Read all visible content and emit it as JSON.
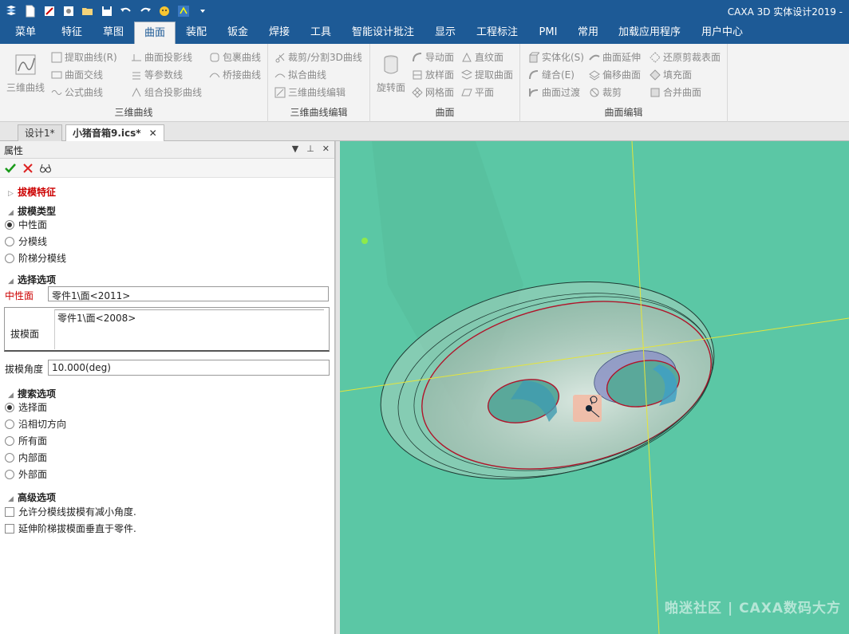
{
  "titlebar": {
    "title": "CAXA 3D 实体设计2019 -"
  },
  "menu": {
    "tabs": [
      {
        "label": "菜单"
      },
      {
        "label": "特征"
      },
      {
        "label": "草图"
      },
      {
        "label": "曲面"
      },
      {
        "label": "装配"
      },
      {
        "label": "钣金"
      },
      {
        "label": "焊接"
      },
      {
        "label": "工具"
      },
      {
        "label": "智能设计批注"
      },
      {
        "label": "显示"
      },
      {
        "label": "工程标注"
      },
      {
        "label": "PMI"
      },
      {
        "label": "常用"
      },
      {
        "label": "加载应用程序"
      },
      {
        "label": "用户中心"
      }
    ],
    "active": "曲面"
  },
  "ribbon": {
    "curves3d": {
      "label": "三维曲线",
      "big": "三维曲线",
      "items": [
        "提取曲线(R)",
        "曲面投影线",
        "包裹曲线",
        "曲面交线",
        "等参数线",
        "桥接曲线",
        "公式曲线",
        "组合投影曲线"
      ]
    },
    "curve_edit": {
      "label": "三维曲线编辑",
      "items": [
        "裁剪/分割3D曲线",
        "拟合曲线",
        "三维曲线编辑"
      ]
    },
    "surface": {
      "label": "曲面",
      "big": "旋转面",
      "items": [
        "导动面",
        "直纹面",
        "放样面",
        "提取曲面",
        "网格面",
        "平面"
      ]
    },
    "surface_edit": {
      "label": "曲面编辑",
      "items": [
        "实体化(S)",
        "曲面延伸",
        "还原剪裁表面",
        "缝合(E)",
        "偏移曲面",
        "填充面",
        "曲面过渡",
        "裁剪",
        "合并曲面"
      ]
    }
  },
  "doc_tabs": [
    {
      "label": "设计1*"
    },
    {
      "label": "小猪音箱9.ics*",
      "close": "✕"
    }
  ],
  "panel": {
    "title": "属性",
    "feature": "拔模特征",
    "type_section": "拔模类型",
    "type_options": [
      "中性面",
      "分模线",
      "阶梯分模线"
    ],
    "type_selected": 0,
    "select_section": "选择选项",
    "neutral_label": "中性面",
    "neutral_value": "零件1\\面<2011>",
    "draft_face_label": "拔模面",
    "draft_face_value": "零件1\\面<2008>",
    "angle_label": "拔模角度",
    "angle_value": "10.000(deg)",
    "search_section": "搜索选项",
    "search_options": [
      "选择面",
      "沿相切方向",
      "所有面",
      "内部面",
      "外部面"
    ],
    "search_selected": 0,
    "advanced_section": "高级选项",
    "advanced_options": [
      "允许分模线拔模有减小角度.",
      "延伸阶梯拔模面垂直于零件."
    ]
  },
  "viewport": {
    "background": "#5bc7a5",
    "watermark": "啪迷社区 | CAXA数码大方"
  }
}
